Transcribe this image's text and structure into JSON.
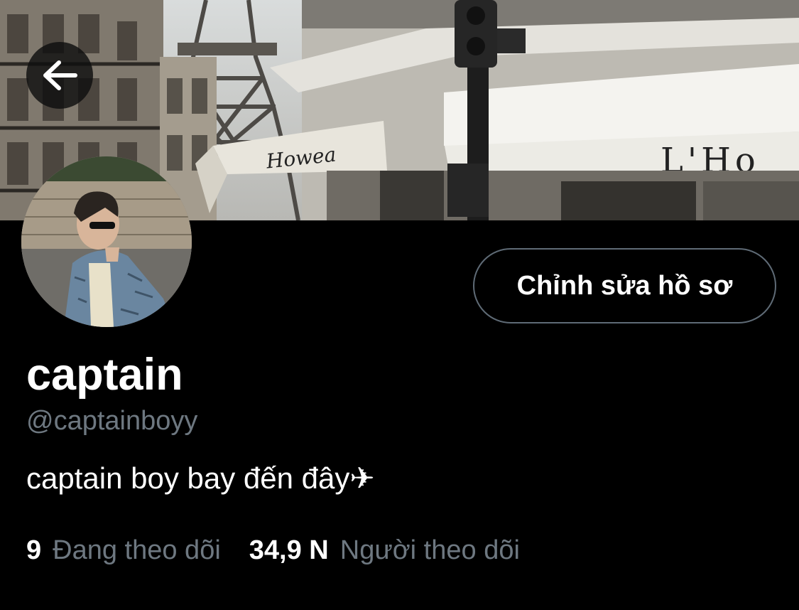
{
  "banner": {
    "awning_left_text": "Howea",
    "awning_right_text": "L'Ho"
  },
  "profile": {
    "display_name": "captain",
    "handle": "@captainboyy",
    "bio": "captain boy bay đến đây✈",
    "edit_button_label": "Chỉnh sửa hồ sơ"
  },
  "stats": {
    "following_count": "9",
    "following_label": "Đang theo dõi",
    "followers_count": "34,9 N",
    "followers_label": "Người theo dõi"
  },
  "icons": {
    "back": "arrow-left-icon",
    "plane": "airplane-emoji"
  },
  "colors": {
    "background": "#000000",
    "secondary_text": "#6e7881",
    "button_border": "#5f6b76"
  }
}
